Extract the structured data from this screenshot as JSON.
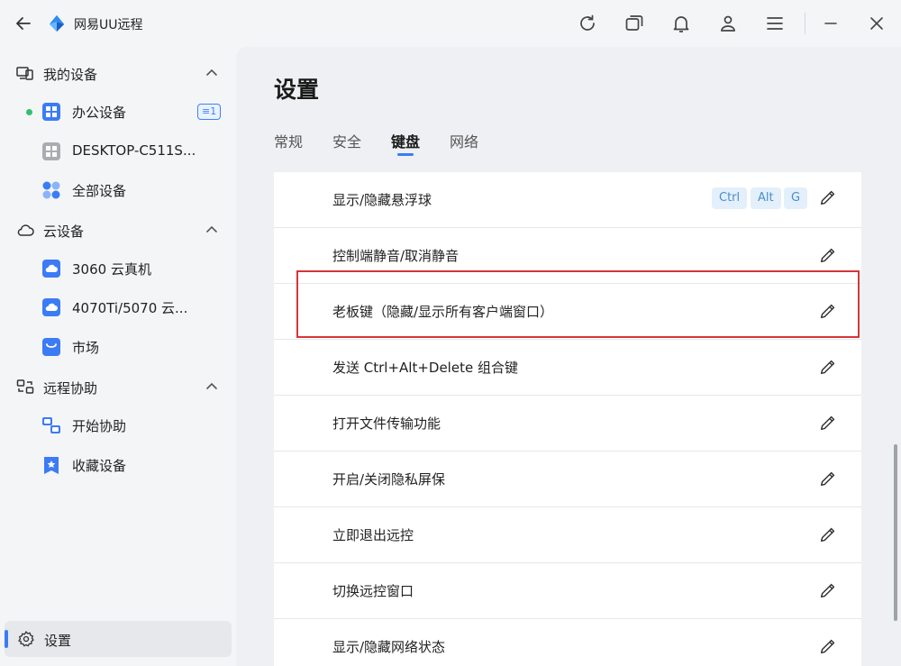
{
  "app": {
    "title": "网易UU远程"
  },
  "sidebar": {
    "groups": [
      {
        "label": "我的设备",
        "items": [
          {
            "label": "办公设备",
            "badge": "1",
            "online": true
          },
          {
            "label": "DESKTOP-C511S..."
          },
          {
            "label": "全部设备"
          }
        ]
      },
      {
        "label": "云设备",
        "items": [
          {
            "label": "3060 云真机"
          },
          {
            "label": "4070Ti/5070 云..."
          },
          {
            "label": "市场"
          }
        ]
      },
      {
        "label": "远程协助",
        "items": [
          {
            "label": "开始协助"
          },
          {
            "label": "收藏设备"
          }
        ]
      }
    ],
    "settings_label": "设置"
  },
  "main": {
    "title": "设置",
    "tabs": [
      {
        "label": "常规",
        "active": false
      },
      {
        "label": "安全",
        "active": false
      },
      {
        "label": "键盘",
        "active": true
      },
      {
        "label": "网络",
        "active": false
      }
    ],
    "shortcuts": [
      {
        "label": "显示/隐藏悬浮球",
        "keys": [
          "Ctrl",
          "Alt",
          "G"
        ]
      },
      {
        "label": "控制端静音/取消静音",
        "keys": []
      },
      {
        "label": "老板键（隐藏/显示所有客户端窗口）",
        "keys": [],
        "highlighted": true
      },
      {
        "label": "发送 Ctrl+Alt+Delete 组合键",
        "keys": []
      },
      {
        "label": "打开文件传输功能",
        "keys": []
      },
      {
        "label": "开启/关闭隐私屏保",
        "keys": []
      },
      {
        "label": "立即退出远控",
        "keys": []
      },
      {
        "label": "切换远控窗口",
        "keys": []
      },
      {
        "label": "显示/隐藏网络状态",
        "keys": []
      }
    ]
  },
  "colors": {
    "accent": "#3b7cf5",
    "highlight_border": "#d6343a",
    "online": "#2ec26a",
    "key_bg": "#e3f0fb",
    "key_text": "#4a8dcb"
  },
  "icons": [
    "back-arrow-icon",
    "uu-logo-icon",
    "refresh-icon",
    "window-switch-icon",
    "bell-icon",
    "user-icon",
    "menu-icon",
    "minimize-icon",
    "close-icon",
    "my-devices-icon",
    "cloud-icon",
    "remote-assist-icon",
    "gear-icon",
    "pencil-icon"
  ]
}
